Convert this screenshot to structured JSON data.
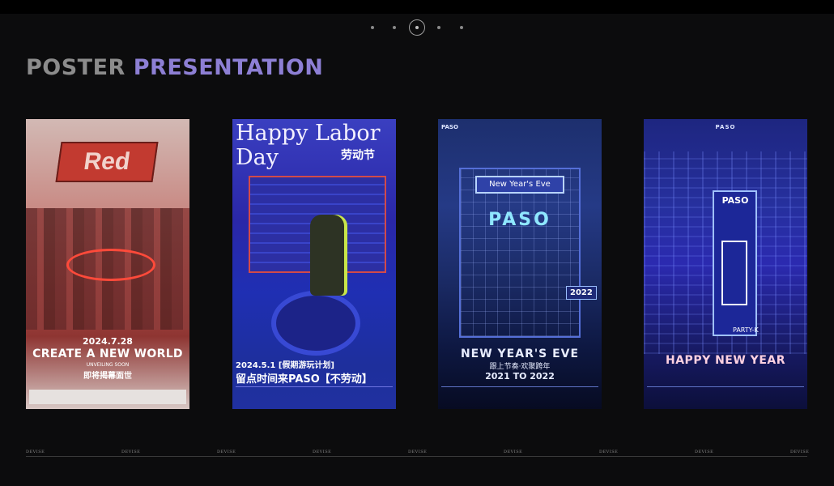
{
  "pager": {
    "total": 5,
    "active_index": 3
  },
  "heading": {
    "word1": "POSTER",
    "word2": "PRESENTATION"
  },
  "colors": {
    "background": "#0c0c0d",
    "heading_gray": "#8c8c8c",
    "heading_purple": "#8d7fd4"
  },
  "posters": [
    {
      "logo": "Red",
      "date": "2024.7.28",
      "headline": "CREATE A NEW WORLD",
      "sub": "UNVEILING SOON",
      "cn": "即将揭幕面世"
    },
    {
      "title_line1": "Happy Labor",
      "title_line2": "Day",
      "cn_title": "劳动节",
      "date": "2024.5.1 [假期游玩计划]",
      "cn_line": "留点时间来PASO【不劳动】"
    },
    {
      "brand": "PASO",
      "sign": "New Year's Eve",
      "logo": "PASO",
      "year_badge": "2022",
      "headline": "NEW YEAR'S EVE",
      "cn": "跟上节奏·欢聚跨年",
      "years": "2021 TO 2022"
    },
    {
      "brand": "PASO",
      "tower_label": "PASO",
      "tower_sub": "PARTY-K",
      "headline": "HAPPY NEW YEAR"
    }
  ],
  "footer": {
    "marks": [
      "DEVISE",
      "DEVISE",
      "DEVISE",
      "DEVISE",
      "DEVISE",
      "DEVISE",
      "DEVISE",
      "DEVISE",
      "DEVISE"
    ]
  }
}
